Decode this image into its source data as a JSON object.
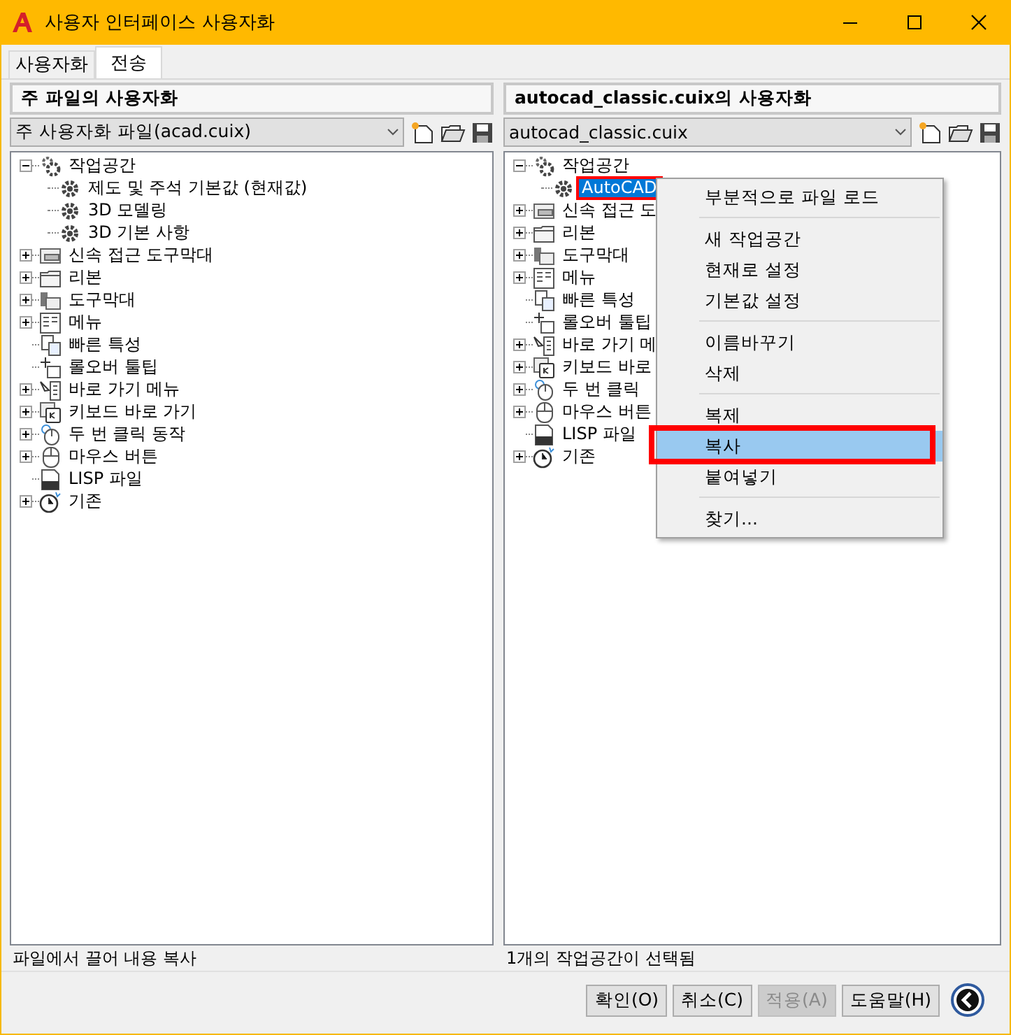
{
  "window": {
    "title": "사용자 인터페이스 사용자화"
  },
  "tabs": [
    {
      "label": "사용자화",
      "selected": false
    },
    {
      "label": "전송",
      "selected": true
    }
  ],
  "panels": [
    {
      "header": "주 파일의 사용자화",
      "file": "주 사용자화 파일(acad.cuix)",
      "status": "파일에서 끌어 내용 복사",
      "tree": [
        {
          "label": "작업공간",
          "kind": "branch",
          "expanded": true,
          "children": [
            {
              "label": "제도 및 주석 기본값 (현재값)",
              "selected": false
            },
            {
              "label": "3D 모델링",
              "selected": false
            },
            {
              "label": "3D 기본 사항",
              "selected": false
            }
          ]
        },
        {
          "label": "신속 접근 도구막대",
          "kind": "branch",
          "expanded": false
        },
        {
          "label": "리본",
          "kind": "branch",
          "expanded": false
        },
        {
          "label": "도구막대",
          "kind": "branch",
          "expanded": false
        },
        {
          "label": "메뉴",
          "kind": "branch",
          "expanded": false
        },
        {
          "label": "빠른 특성",
          "kind": "leaf"
        },
        {
          "label": "롤오버 툴팁",
          "kind": "leaf"
        },
        {
          "label": "바로 가기 메뉴",
          "kind": "branch",
          "expanded": false
        },
        {
          "label": "키보드 바로 가기",
          "kind": "branch",
          "expanded": false
        },
        {
          "label": "두 번 클릭 동작",
          "kind": "branch",
          "expanded": false
        },
        {
          "label": "마우스 버튼",
          "kind": "branch",
          "expanded": false
        },
        {
          "label": "LISP 파일",
          "kind": "leaf"
        },
        {
          "label": "기존",
          "kind": "branch",
          "expanded": false
        }
      ]
    },
    {
      "header": "autocad_classic.cuix의 사용자화",
      "file": "autocad_classic.cuix",
      "status": "1개의 작업공간이 선택됨",
      "tree": [
        {
          "label": "작업공간",
          "kind": "branch",
          "expanded": true,
          "children": [
            {
              "label": "AutoCAD",
              "selected": true
            }
          ]
        },
        {
          "label": "신속 접근 도",
          "kind": "branch",
          "expanded": false
        },
        {
          "label": "리본",
          "kind": "branch",
          "expanded": false
        },
        {
          "label": "도구막대",
          "kind": "branch",
          "expanded": false
        },
        {
          "label": "메뉴",
          "kind": "branch",
          "expanded": false
        },
        {
          "label": "빠른 특성",
          "kind": "leaf"
        },
        {
          "label": "롤오버 툴팁",
          "kind": "leaf"
        },
        {
          "label": "바로 가기 메",
          "kind": "branch",
          "expanded": false
        },
        {
          "label": "키보드 바로",
          "kind": "branch",
          "expanded": false
        },
        {
          "label": "두 번 클릭",
          "kind": "branch",
          "expanded": false
        },
        {
          "label": "마우스 버튼",
          "kind": "branch",
          "expanded": false
        },
        {
          "label": "LISP 파일",
          "kind": "leaf"
        },
        {
          "label": "기존",
          "kind": "branch",
          "expanded": false
        }
      ]
    }
  ],
  "context_menu": {
    "items": [
      {
        "kind": "item",
        "label": "부분적으로 파일 로드",
        "selected": false
      },
      {
        "kind": "separator"
      },
      {
        "kind": "item",
        "label": "새 작업공간",
        "selected": false
      },
      {
        "kind": "item",
        "label": "현재로 설정",
        "selected": false
      },
      {
        "kind": "item",
        "label": "기본값 설정",
        "selected": false
      },
      {
        "kind": "separator"
      },
      {
        "kind": "item",
        "label": "이름바꾸기",
        "selected": false
      },
      {
        "kind": "item",
        "label": "삭제",
        "selected": false
      },
      {
        "kind": "separator"
      },
      {
        "kind": "item",
        "label": "복제",
        "selected": false
      },
      {
        "kind": "item",
        "label": "복사",
        "selected": true
      },
      {
        "kind": "item",
        "label": "붙여넣기",
        "selected": false
      },
      {
        "kind": "separator"
      },
      {
        "kind": "item",
        "label": "찾기...",
        "selected": false
      }
    ]
  },
  "buttons": [
    {
      "label": "확인(O)",
      "disabled": false
    },
    {
      "label": "취소(C)",
      "disabled": false
    },
    {
      "label": "적용(A)",
      "disabled": true
    },
    {
      "label": "도움말(H)",
      "disabled": false
    }
  ]
}
